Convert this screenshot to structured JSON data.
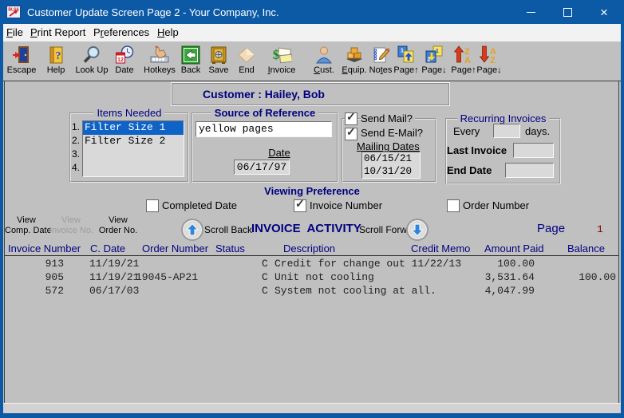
{
  "window": {
    "title": "Customer Update Screen Page 2 - Your Company, Inc.",
    "icon_label": "BLSS",
    "controls": {
      "minimize": "minimize-icon",
      "maximize": "maximize-icon",
      "close": "close-icon"
    }
  },
  "menu": [
    {
      "pre": "",
      "key": "F",
      "rest": "ile"
    },
    {
      "pre": "",
      "key": "P",
      "rest": "rint Report"
    },
    {
      "pre": "P",
      "key": "r",
      "rest": "eferences"
    },
    {
      "pre": "",
      "key": "H",
      "rest": "elp"
    }
  ],
  "toolbar": [
    {
      "pre": "Escape",
      "key": "",
      "rest": "",
      "icon": "door-escape-icon"
    },
    {
      "pre": "Help",
      "key": "",
      "rest": "",
      "icon": "help-book-icon"
    },
    {
      "pre": "Look Up",
      "key": "",
      "rest": "",
      "icon": "magnifier-icon"
    },
    {
      "pre": "Date",
      "key": "",
      "rest": "",
      "icon": "calendar-clock-icon"
    },
    {
      "pre": "Hotkeys",
      "key": "",
      "rest": "",
      "icon": "hand-keyboard-icon"
    },
    {
      "pre": "Back",
      "key": "",
      "rest": "",
      "icon": "back-arrow-icon"
    },
    {
      "pre": "Save",
      "key": "",
      "rest": "",
      "icon": "safe-icon"
    },
    {
      "pre": "End",
      "key": "",
      "rest": "",
      "icon": "diamond-icon"
    },
    {
      "pre": "",
      "key": "I",
      "rest": "nvoice",
      "icon": "dollar-envelope-icon"
    },
    {
      "pre": "",
      "key": "C",
      "rest": "ust.",
      "icon": "person-icon"
    },
    {
      "pre": "",
      "key": "E",
      "rest": "quip.",
      "icon": "crates-icon"
    },
    {
      "pre": "No",
      "key": "t",
      "rest": "es",
      "icon": "notepad-pencil-icon"
    },
    {
      "pre": "Page↑",
      "key": "",
      "rest": "",
      "icon": "pages-up-icon"
    },
    {
      "pre": "Page↓",
      "key": "",
      "rest": "",
      "icon": "pages-down-icon"
    },
    {
      "pre": "Page↑",
      "key": "",
      "rest": "",
      "icon": "sort-za-up-icon"
    },
    {
      "pre": "Page↓",
      "key": "",
      "rest": "",
      "icon": "sort-az-down-icon"
    }
  ],
  "customer_banner": "Customer : Hailey, Bob",
  "items_needed": {
    "title": "Items Needed",
    "items": [
      {
        "num": "1.",
        "text": "Filter Size 1",
        "selected": true
      },
      {
        "num": "2.",
        "text": "Filter Size 2",
        "selected": false
      },
      {
        "num": "3.",
        "text": "",
        "selected": false
      },
      {
        "num": "4.",
        "text": "",
        "selected": false
      }
    ]
  },
  "source_of_reference": {
    "title": "Source of Reference",
    "value": "yellow pages",
    "date_label": "Date",
    "date_value": "06/17/97"
  },
  "mailing": {
    "send_mail_label": "Send Mail?",
    "send_mail_checked": true,
    "send_email_label": "Send E-Mail?",
    "send_email_checked": true,
    "dates_label": "Mailing Dates",
    "dates": [
      "06/15/21",
      "10/31/20"
    ]
  },
  "recurring": {
    "title": "Recurring Invoices",
    "every_label": "Every",
    "every_value": "",
    "days_label": "days.",
    "last_invoice_label": "Last Invoice",
    "last_invoice_value": "",
    "end_date_label": "End Date",
    "end_date_value": ""
  },
  "viewing_preference": {
    "title": "Viewing Preference",
    "options": [
      {
        "label": "Completed Date",
        "checked": false
      },
      {
        "label": "Invoice Number",
        "checked": true
      },
      {
        "label": "Order Number",
        "checked": false
      }
    ]
  },
  "activity": {
    "view_buttons": [
      {
        "line1": "View",
        "line2": "Comp. Date",
        "enabled": true
      },
      {
        "line1": "View",
        "line2": "Invoice No.",
        "enabled": false
      },
      {
        "line1": "View",
        "line2": "Order No.",
        "enabled": true
      }
    ],
    "scroll_back_label": "Scroll Back",
    "title": "INVOICE  ACTIVITY",
    "scroll_forward_label": "Scroll Forward",
    "page_label": "Page",
    "page_number": "1"
  },
  "invoice_table": {
    "headers": [
      "Invoice Number",
      "C. Date",
      "Order Number",
      "Status",
      "Description",
      "Credit Memo",
      "Amount Paid",
      "Balance"
    ],
    "rows": [
      [
        "913",
        "11/19/21",
        "",
        "C",
        "Credit for change out 11/22/13",
        "",
        "100.00",
        ""
      ],
      [
        "905",
        "11/19/21",
        "19045-AP21",
        "C",
        "Unit not cooling",
        "",
        "3,531.64",
        "100.00"
      ],
      [
        "572",
        "06/17/03",
        "",
        "C",
        "System not cooling at all.",
        "",
        "4,047.99",
        ""
      ]
    ]
  },
  "colors": {
    "titlebar": "#0c59a6",
    "navy_text": "#000080",
    "page_number_red": "#8b0000",
    "selection_highlight": "#0f62c6",
    "window_bg": "#c0c0c0"
  }
}
